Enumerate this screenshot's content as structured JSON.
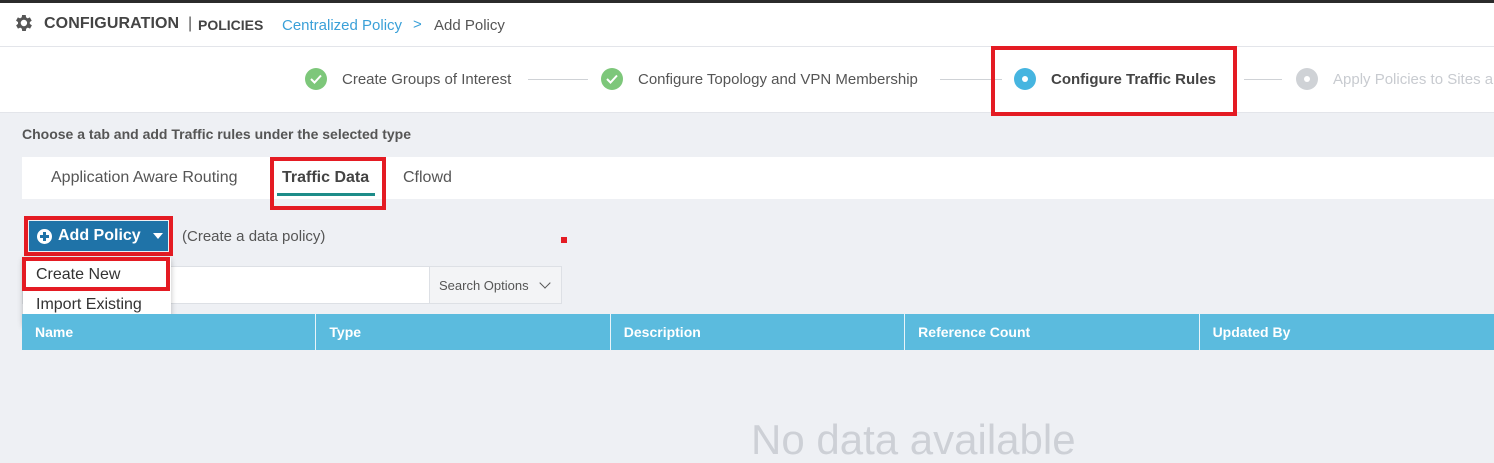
{
  "header": {
    "title": "CONFIGURATION",
    "separator": "|",
    "subtitle": "POLICIES",
    "breadcrumb_link": "Centralized Policy",
    "breadcrumb_sep": ">",
    "breadcrumb_current": "Add Policy"
  },
  "stepper": {
    "steps": [
      {
        "label": "Create Groups of Interest",
        "state": "done"
      },
      {
        "label": "Configure Topology and VPN Membership",
        "state": "done"
      },
      {
        "label": "Configure Traffic Rules",
        "state": "active"
      },
      {
        "label": "Apply Policies to Sites a",
        "state": "pending"
      }
    ]
  },
  "main": {
    "instruction": "Choose a tab and add Traffic rules under the selected type",
    "tabs": [
      {
        "label": "Application Aware Routing",
        "selected": false
      },
      {
        "label": "Traffic Data",
        "selected": true
      },
      {
        "label": "Cflowd",
        "selected": false
      }
    ],
    "add_policy_label": "Add Policy",
    "add_policy_note": "(Create a data policy)",
    "dropdown": {
      "items": [
        "Create New",
        "Import Existing"
      ]
    },
    "search": {
      "placeholder": "",
      "options_label": "Search Options"
    },
    "table": {
      "columns": [
        "Name",
        "Type",
        "Description",
        "Reference Count",
        "Updated By"
      ],
      "empty_text": "No data available"
    }
  },
  "colors": {
    "accent_blue": "#1f73a8",
    "table_header": "#5bbbde",
    "highlight_red": "#e41b23",
    "done_green": "#7dc77a",
    "active_blue": "#46b5e0"
  }
}
